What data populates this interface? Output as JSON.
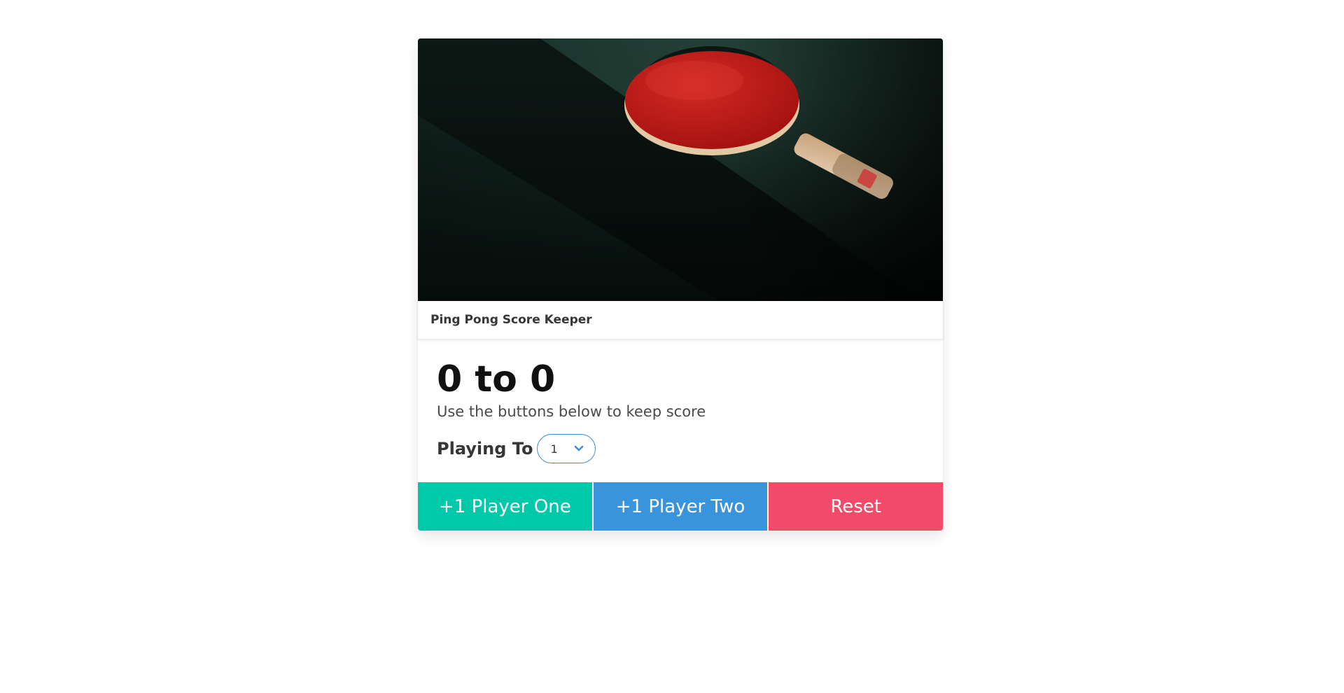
{
  "card": {
    "header_title": "Ping Pong Score Keeper",
    "image_description_icon": "ping-pong-paddle-photo"
  },
  "score": {
    "player_one": 0,
    "player_two": 0,
    "display": "0 to 0"
  },
  "subtitle": "Use the buttons below to keep score",
  "playing_to": {
    "label": "Playing To",
    "selected": "1"
  },
  "buttons": {
    "player_one": "+1 Player One",
    "player_two": "+1 Player Two",
    "reset": "Reset"
  },
  "colors": {
    "player_one": "#00c9aa",
    "player_two": "#3a94dc",
    "reset": "#f24b6a",
    "select_border": "#3e8ed0"
  }
}
